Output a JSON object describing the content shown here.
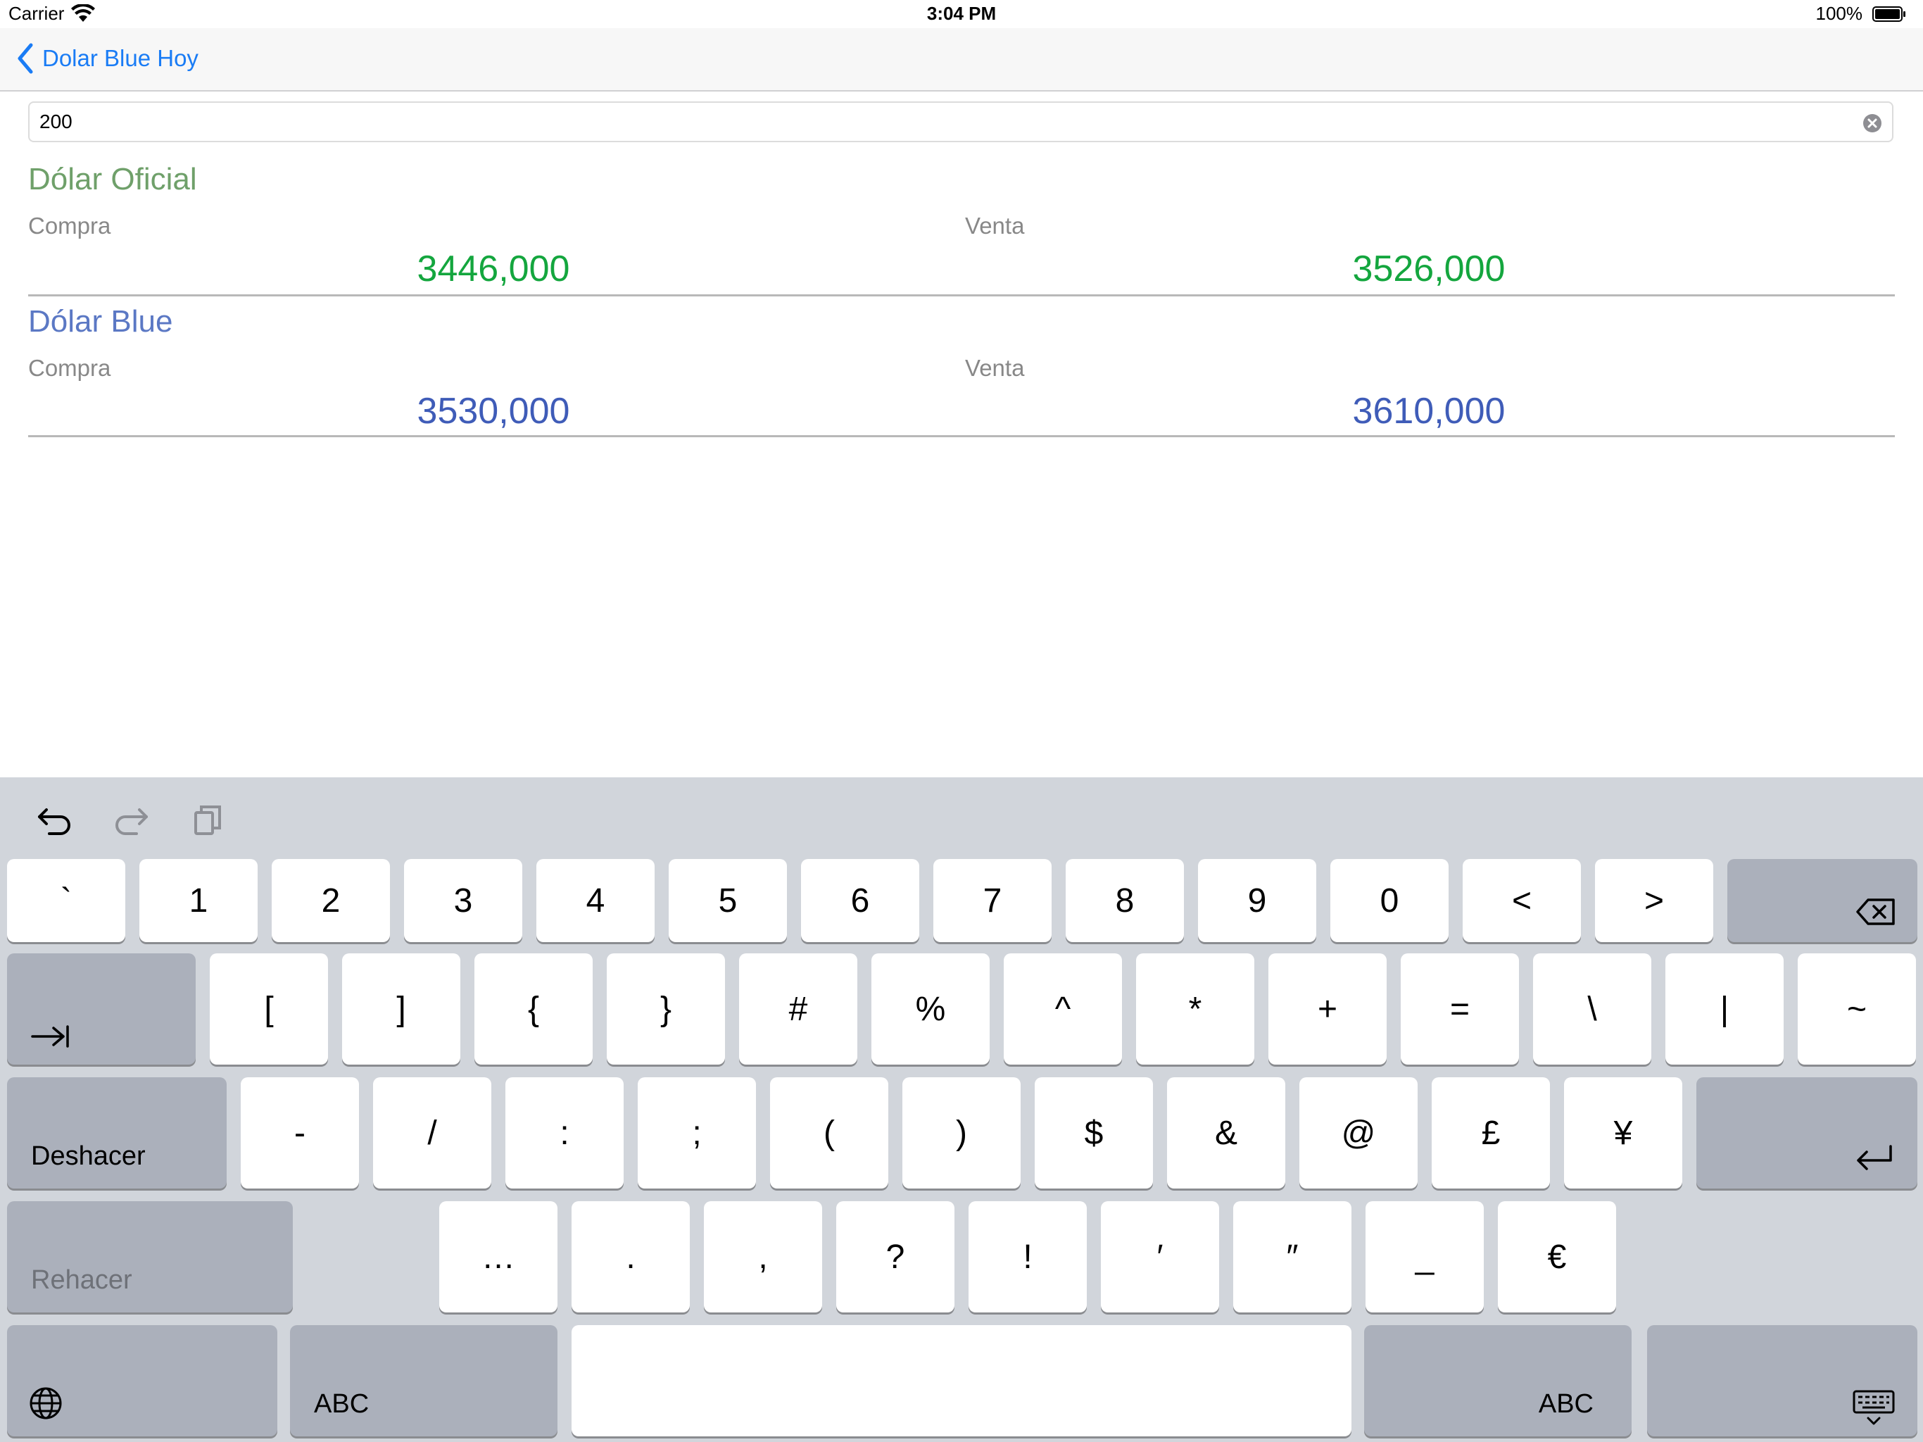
{
  "status_bar": {
    "carrier": "Carrier",
    "time": "3:04 PM",
    "battery": "100%"
  },
  "nav": {
    "back_label": "Dolar Blue Hoy"
  },
  "search": {
    "value": "200"
  },
  "oficial": {
    "title": "Dólar Oficial",
    "compra_label": "Compra",
    "venta_label": "Venta",
    "compra_value": "3446,000",
    "venta_value": "3526,000"
  },
  "blue": {
    "title": "Dólar Blue",
    "compra_label": "Compra",
    "venta_label": "Venta",
    "compra_value": "3530,000",
    "venta_value": "3610,000"
  },
  "colors": {
    "accent": "#1a7cf5",
    "oficial_title": "#6fa06a",
    "oficial_value": "#14a63e",
    "blue_title": "#5b78c4",
    "blue_value": "#3f5cb8"
  },
  "keyboard": {
    "row1": [
      "`",
      "1",
      "2",
      "3",
      "4",
      "5",
      "6",
      "7",
      "8",
      "9",
      "0",
      "<",
      ">"
    ],
    "row2": [
      "[",
      "]",
      "{",
      "}",
      "#",
      "%",
      "^",
      "*",
      "+",
      "=",
      "\\",
      "|",
      "~"
    ],
    "row3": [
      "-",
      "/",
      ":",
      ";",
      "(",
      ")",
      "$",
      "&",
      "@",
      "£",
      "¥"
    ],
    "row4": [
      "…",
      ".",
      ",",
      "?",
      "!",
      "′",
      "″",
      "_",
      "€"
    ],
    "undo_label": "Deshacer",
    "redo_label": "Rehacer",
    "abc_label": "ABC"
  }
}
